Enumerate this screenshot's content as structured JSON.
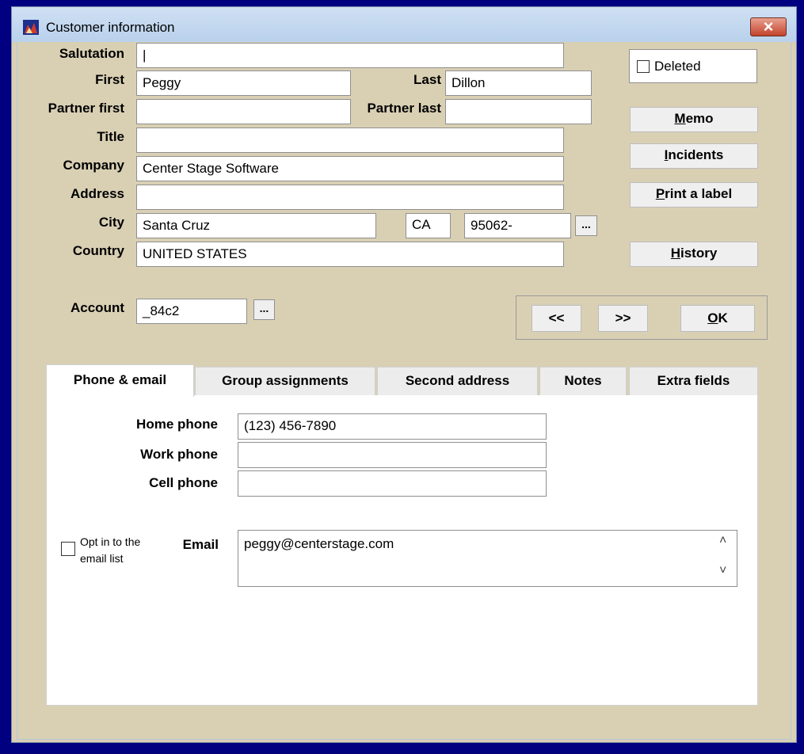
{
  "window": {
    "title": "Customer information",
    "close_glyph": "×"
  },
  "labels": {
    "salutation": "Salutation",
    "first": "First",
    "last": "Last",
    "partner_first": "Partner first",
    "partner_last": "Partner last",
    "title": "Title",
    "company": "Company",
    "address": "Address",
    "city": "City",
    "country": "Country",
    "account": "Account"
  },
  "fields": {
    "salutation": "|",
    "first": "Peggy",
    "last": "Dillon",
    "partner_first": "",
    "partner_last": "",
    "title": "",
    "company": "Center Stage Software",
    "address": "",
    "city": "Santa Cruz",
    "state": "CA",
    "zip": "95062-",
    "country": "UNITED STATES",
    "account": "_84c2"
  },
  "ellipsis": "...",
  "deleted_label": "Deleted",
  "buttons": {
    "memo_key": "M",
    "memo_rest": "emo",
    "incidents_key": "I",
    "incidents_rest": "ncidents",
    "print_key": "P",
    "print_rest": "rint a label",
    "history_key": "H",
    "history_rest": "istory",
    "prev": "<<",
    "next": ">>",
    "ok_key": "O",
    "ok_rest": "K"
  },
  "tabs": [
    "Phone & email",
    "Group assignments",
    "Second address",
    "Notes",
    "Extra fields"
  ],
  "phone_tab": {
    "home_label": "Home phone",
    "home_value": "(123) 456-7890",
    "work_label": "Work phone",
    "work_value": "",
    "cell_label": "Cell phone",
    "cell_value": "",
    "opt_in_line1": "Opt in to the",
    "opt_in_line2": "email list",
    "email_label": "Email",
    "email_value": "peggy@centerstage.com",
    "scroll_up": "˄",
    "scroll_down": "˅"
  }
}
